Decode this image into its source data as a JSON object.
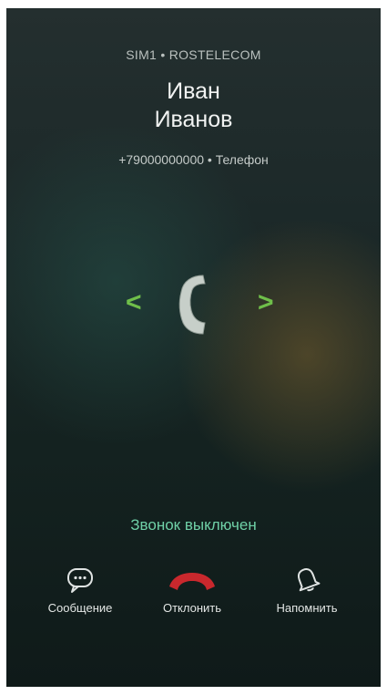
{
  "header": {
    "carrier": "SIM1 • ROSTELECOM",
    "first_name": "Иван",
    "last_name": "Иванов",
    "number_line": "+79000000000 • Телефон"
  },
  "swipe": {
    "left_arrow": "<",
    "right_arrow": ">"
  },
  "status_text": "Звонок выключен",
  "actions": [
    {
      "label": "Сообщение",
      "icon": "message-icon"
    },
    {
      "label": "Отклонить",
      "icon": "decline-call-icon"
    },
    {
      "label": "Напомнить",
      "icon": "bell-icon"
    }
  ],
  "colors": {
    "accent_green": "#6fbf4a",
    "status_teal": "#6fd0a7",
    "decline_red": "#c9282d"
  }
}
